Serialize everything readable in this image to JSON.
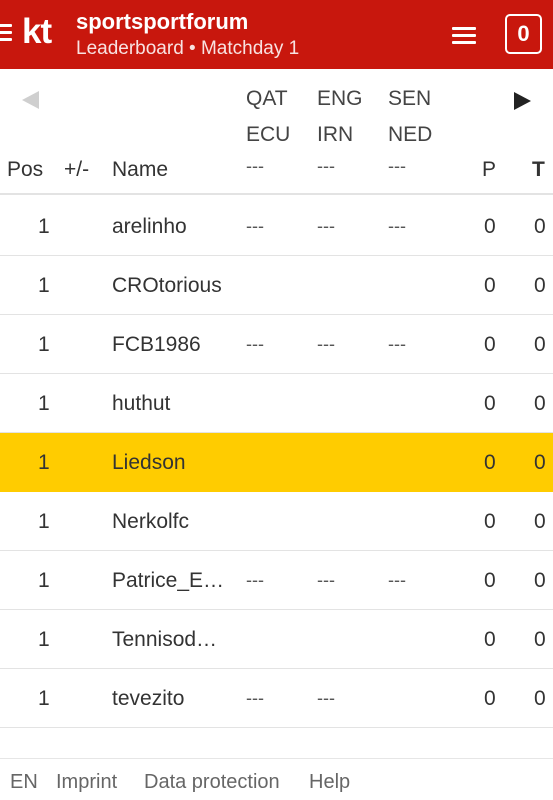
{
  "header": {
    "logo": "kt",
    "title": "sportsportforum",
    "subtitle": "Leaderboard • Matchday 1",
    "counter": "0",
    "icons": {
      "menu_left": "hamburger-icon",
      "menu_right": "hamburger-icon"
    },
    "color": "#c8170d"
  },
  "table": {
    "nav": {
      "prev": "arrow-left-icon",
      "next": "arrow-right-icon"
    },
    "matches": [
      {
        "home": "QAT",
        "away": "ECU",
        "result": "---"
      },
      {
        "home": "ENG",
        "away": "IRN",
        "result": "---"
      },
      {
        "home": "SEN",
        "away": "NED",
        "result": "---"
      }
    ],
    "columns": {
      "pos": "Pos",
      "change": "+/-",
      "name": "Name",
      "points": "P",
      "total": "T"
    },
    "rows": [
      {
        "pos": "1",
        "name": "arelinho",
        "m1": "---",
        "m2": "---",
        "m3": "---",
        "p": "0",
        "t": "0",
        "highlight": false
      },
      {
        "pos": "1",
        "name": "CROtorious",
        "m1": "",
        "m2": "",
        "m3": "",
        "p": "0",
        "t": "0",
        "highlight": false
      },
      {
        "pos": "1",
        "name": "FCB1986",
        "m1": "---",
        "m2": "---",
        "m3": "---",
        "p": "0",
        "t": "0",
        "highlight": false
      },
      {
        "pos": "1",
        "name": "huthut",
        "m1": "",
        "m2": "",
        "m3": "",
        "p": "0",
        "t": "0",
        "highlight": false
      },
      {
        "pos": "1",
        "name": "Liedson",
        "m1": "",
        "m2": "",
        "m3": "",
        "p": "0",
        "t": "0",
        "highlight": true
      },
      {
        "pos": "1",
        "name": "Nerkolfc",
        "m1": "",
        "m2": "",
        "m3": "",
        "p": "0",
        "t": "0",
        "highlight": false
      },
      {
        "pos": "1",
        "name": "Patrice_E…",
        "m1": "---",
        "m2": "---",
        "m3": "---",
        "p": "0",
        "t": "0",
        "highlight": false
      },
      {
        "pos": "1",
        "name": "Tennisod…",
        "m1": "",
        "m2": "",
        "m3": "",
        "p": "0",
        "t": "0",
        "highlight": false
      },
      {
        "pos": "1",
        "name": "tevezito",
        "m1": "---",
        "m2": "---",
        "m3": "",
        "p": "0",
        "t": "0",
        "highlight": false
      }
    ],
    "highlight_color": "#ffcc00"
  },
  "footer": {
    "links": [
      "EN",
      "Imprint",
      "Data protection",
      "Help"
    ]
  }
}
